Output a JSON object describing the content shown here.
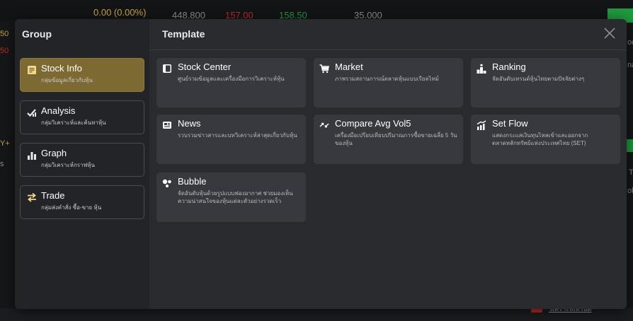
{
  "background": {
    "header_values": [
      "0.00 (0.00%)",
      "448.800",
      "157.00",
      "158.50",
      "35.000"
    ],
    "left_edge": [
      "50",
      "50",
      "Y+",
      "s"
    ],
    "right_edge": [
      "oc",
      "na",
      "T",
      "ol"
    ],
    "bottom_link": "วิเคราะห์เทรนด์"
  },
  "modal": {
    "group_title": "Group",
    "template_title": "Template"
  },
  "groups": [
    {
      "title": "Stock Info",
      "subtitle": "กลุ่มข้อมูลเกี่ยวกับหุ้น",
      "icon": "document-icon",
      "active": true
    },
    {
      "title": "Analysis",
      "subtitle": "กลุ่มวิเคราะห์และค้นหาหุ้น",
      "icon": "check-chart-icon",
      "active": false
    },
    {
      "title": "Graph",
      "subtitle": "กลุ่มวิเคราะห์กราฟหุ้น",
      "icon": "bar-chart-icon",
      "active": false
    },
    {
      "title": "Trade",
      "subtitle": "กลุ่มส่งคำสั่ง ซื้อ-ขาย หุ้น",
      "icon": "exchange-icon",
      "active": false
    }
  ],
  "templates": [
    {
      "title": "Stock Center",
      "desc": "ศูนย์รวมข้อมูลและเครื่องมือการวิเคราะห์หุ้น",
      "icon": "panel-icon"
    },
    {
      "title": "Market",
      "desc": "ภาพรวมสถานการณ์ตลาดหุ้นแบบเรียลไทม์",
      "icon": "cart-icon"
    },
    {
      "title": "Ranking",
      "desc": "จัดอันดับเทรนด์หุ้นไทยตามปัจจัยต่างๆ",
      "icon": "podium-icon"
    },
    {
      "title": "News",
      "desc": "รวบรวมข่าวสารและบทวิเคราะห์ล่าสุดเกี่ยวกับหุ้น",
      "icon": "newspaper-icon"
    },
    {
      "title": "Compare Avg Vol5",
      "desc": "เครื่องมือเปรียบเทียบปริมาณการซื้อขายเฉลี่ย 5 วันของหุ้น",
      "icon": "arrows-icon"
    },
    {
      "title": "Set Flow",
      "desc": "แสดงกระแสเงินทุนไหลเข้าและออกจากตลาดหลักทรัพย์แห่งประเทศไทย (SET)",
      "icon": "flow-chart-icon"
    },
    {
      "title": "Bubble",
      "desc": "จัดอันดับหุ้นด้วยรูปแบบฟองอากาศ ช่วยมองเห็นความน่าสนใจของหุ้นแต่ละตัวอย่างรวดเร็ว",
      "icon": "bubble-icon"
    }
  ],
  "colors": {
    "accent": "#7d6a32",
    "modal_bg": "#2a2b2f",
    "card_bg": "#38393e"
  }
}
